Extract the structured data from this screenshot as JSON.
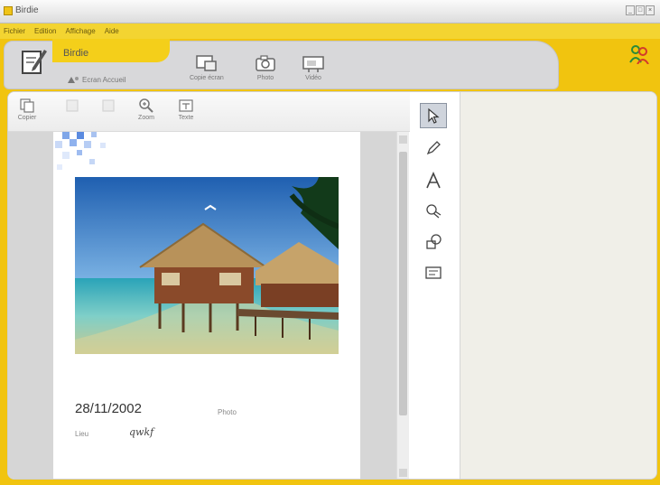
{
  "window": {
    "title": "Birdie"
  },
  "menu": {
    "items": [
      "Fichier",
      "Edition",
      "Affichage",
      "Aide"
    ]
  },
  "header": {
    "title": "Birdie",
    "image_link": "Ecran Accueil",
    "tools": [
      {
        "label": "Copie écran",
        "icon": "screen-copy-icon"
      },
      {
        "label": "Photo",
        "icon": "camera-icon"
      },
      {
        "label": "Vidéo",
        "icon": "video-icon"
      }
    ]
  },
  "doc_toolbar": {
    "buttons": [
      {
        "label": "Copier"
      },
      {
        "label": ""
      },
      {
        "label": ""
      },
      {
        "label": "Zoom"
      },
      {
        "label": "Texte"
      }
    ]
  },
  "page": {
    "date": "28/11/2002",
    "label_right": "Photo",
    "label_left": "Lieu",
    "signature": "qwkf"
  },
  "palette": {
    "tools": [
      "select-arrow-icon",
      "pencil-icon",
      "text-tool-icon",
      "stamp-icon",
      "shapes-icon",
      "frame-icon"
    ],
    "active_index": 0
  },
  "colors": {
    "accent": "#f1c40f",
    "panel": "#d8d8da"
  }
}
